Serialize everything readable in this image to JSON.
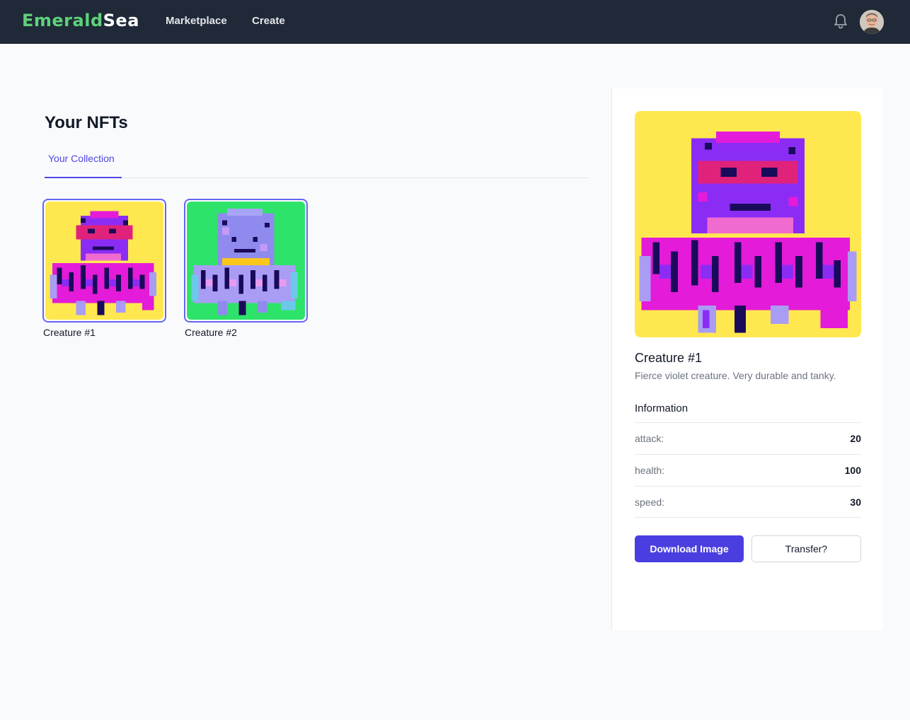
{
  "header": {
    "brand_part1": "Emerald",
    "brand_part2": "Sea",
    "brand_colors": {
      "primary": "#5fd17a",
      "secondary": "#ffffff"
    },
    "nav": [
      {
        "label": "Marketplace"
      },
      {
        "label": "Create"
      }
    ],
    "notification_icon": "bell-icon",
    "avatar_icon": "user-avatar"
  },
  "main": {
    "title": "Your NFTs",
    "tabs": [
      {
        "label": "Your Collection",
        "active": true
      }
    ],
    "collection": [
      {
        "name": "Creature #1",
        "selected": true,
        "background": "#ffe84f"
      },
      {
        "name": "Creature #2",
        "selected": false,
        "background": "#2ee36a"
      }
    ]
  },
  "detail": {
    "title": "Creature #1",
    "description": "Fierce violet creature. Very durable and tanky.",
    "info_heading": "Information",
    "attributes": [
      {
        "key": "attack:",
        "value": "20"
      },
      {
        "key": "health:",
        "value": "100"
      },
      {
        "key": "speed:",
        "value": "30"
      }
    ],
    "primary_button": "Download Image",
    "secondary_button": "Transfer?"
  },
  "colors": {
    "accent": "#4f46e5",
    "nav_bg": "#1f2937",
    "page_bg": "#f9fafb"
  }
}
